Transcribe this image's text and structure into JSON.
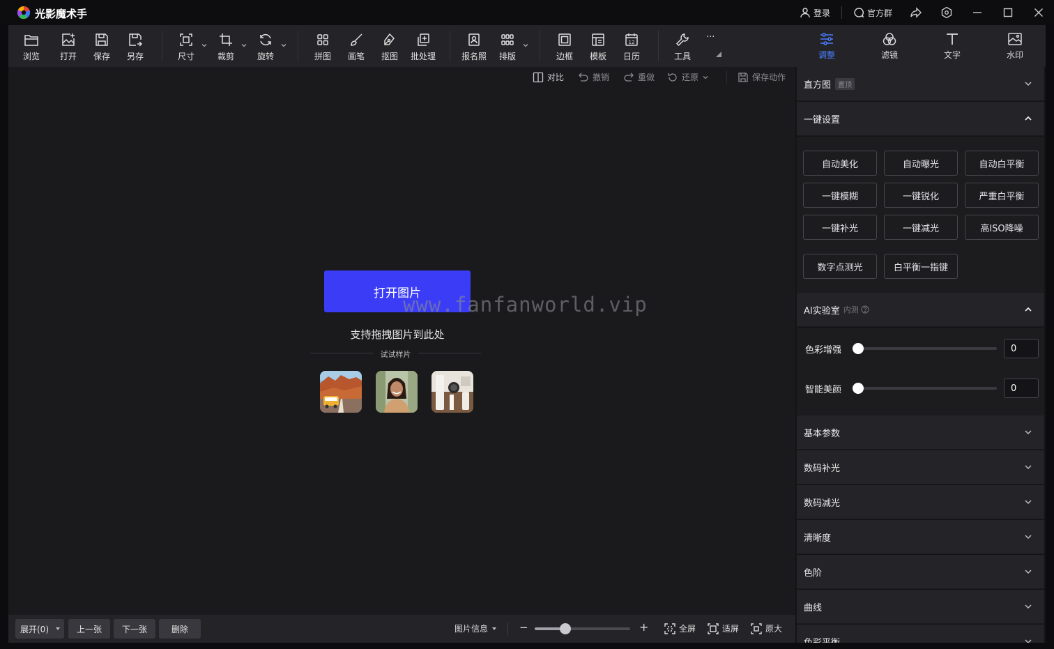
{
  "app": {
    "title": "光影魔术手"
  },
  "titlebar": {
    "login": "登录",
    "community": "官方群"
  },
  "toolbar": {
    "browse": "浏览",
    "open": "打开",
    "save": "保存",
    "save_as": "另存",
    "size": "尺寸",
    "crop": "裁剪",
    "rotate": "旋转",
    "collage": "拼图",
    "brush": "画笔",
    "cutout": "抠图",
    "batch": "批处理",
    "id_photo": "报名照",
    "layout": "排版",
    "border": "边框",
    "template": "模板",
    "calendar": "日历",
    "tools": "工具",
    "more": "···"
  },
  "subbar": {
    "compare": "对比",
    "undo": "撤销",
    "redo": "重做",
    "restore": "还原",
    "save_action": "保存动作"
  },
  "canvas": {
    "open_button": "打开图片",
    "drop_hint": "支持拖拽图片到此处",
    "samples_label": "试试样片",
    "watermark": "www.fanfanworld.vip"
  },
  "statusbar": {
    "expand": "展开(0)",
    "prev": "上一张",
    "next": "下一张",
    "delete": "删除",
    "image_info": "图片信息",
    "zoom_minus": "−",
    "zoom_plus": "+",
    "zoom_level": 0.32,
    "fullscreen": "全屏",
    "fit": "适屏",
    "original": "原大"
  },
  "right_tabs": {
    "adjust": "调整",
    "filter": "滤镜",
    "text": "文字",
    "watermark": "水印"
  },
  "panel": {
    "histogram": "直方图",
    "pin": "置顶",
    "one_click": "一键设置",
    "buttons": [
      "自动美化",
      "自动曝光",
      "自动白平衡",
      "一键模糊",
      "一键锐化",
      "严重白平衡",
      "一键补光",
      "一键减光",
      "高ISO降噪",
      "数字点测光",
      "白平衡一指键"
    ],
    "ai_lab": "AI实验室",
    "beta": "内测",
    "color_enhance": "色彩增强",
    "color_enhance_value": "0",
    "smart_beauty": "智能美颜",
    "smart_beauty_value": "0",
    "basic": "基本参数",
    "fill_light": "数码补光",
    "reduce_light": "数码减光",
    "clarity": "清晰度",
    "levels": "色阶",
    "curves": "曲线",
    "color_balance": "色彩平衡"
  },
  "colors": {
    "accent": "#3a3df5",
    "active_tab": "#4a7dff"
  }
}
